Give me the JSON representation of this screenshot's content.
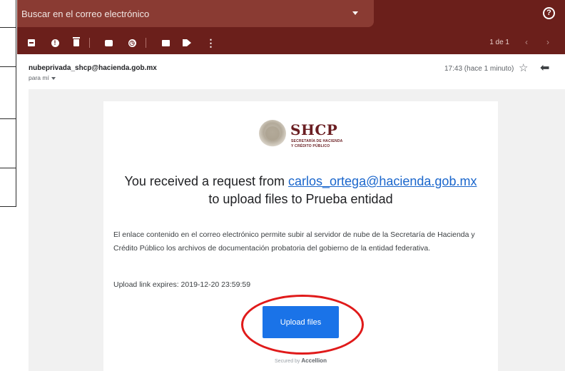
{
  "search": {
    "placeholder": "Buscar en el correo electrónico"
  },
  "header": {
    "help_icon": "help-circle-icon"
  },
  "toolbar": {
    "icons": [
      "archive-icon",
      "report-spam-icon",
      "delete-icon",
      "mark-unread-icon",
      "snooze-icon",
      "move-to-icon",
      "labels-icon",
      "more-icon"
    ],
    "pager": "1 de 1",
    "prev": "‹",
    "next": "›"
  },
  "message": {
    "sender": "nubeprivada_shcp@hacienda.gob.mx",
    "recipient": "para mí",
    "timestamp": "17:43 (hace 1 minuto)",
    "star": "☆",
    "reply": "🡄"
  },
  "email": {
    "logo": {
      "title": "SHCP",
      "subtitle_line1": "SECRETARÍA DE HACIENDA",
      "subtitle_line2": "Y CRÉDITO PÚBLICO"
    },
    "headline_prefix": "You received a request from ",
    "headline_link": "carlos_ortega@hacienda.gob.mx",
    "headline_suffix": "to upload files to Prueba entidad",
    "body": "El enlace contenido en el correo electrónico permite subir al servidor de nube de la Secretaría de Hacienda y Crédito Público los archivos de documentación probatoria del gobierno de la entidad federativa.",
    "expires": "Upload link expires: 2019-12-20 23:59:59",
    "button": "Upload files",
    "secured_prefix": "Secured by",
    "secured_brand": "Accellion"
  },
  "colors": {
    "header_bg": "#6b1f1b",
    "search_bg": "#8a3b33",
    "button_bg": "#1a73e8",
    "link": "#1a66cc",
    "highlight_circle": "#e01a1a",
    "brand": "#6a1e22"
  }
}
